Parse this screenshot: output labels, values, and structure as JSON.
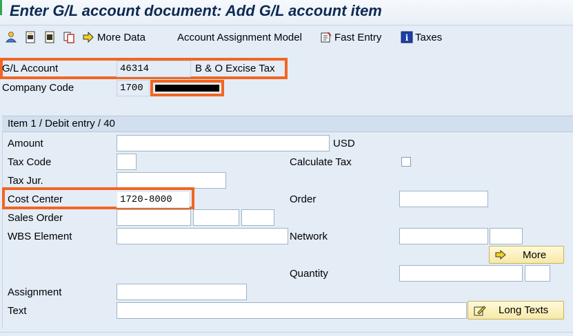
{
  "window": {
    "title": "Enter G/L account document: Add G/L account item"
  },
  "toolbar": {
    "items": [
      {
        "icon": "person-icon"
      },
      {
        "icon": "save-document-icon"
      },
      {
        "icon": "display-document-icon"
      },
      {
        "icon": "copy-icon"
      },
      {
        "icon": "arrow-right-icon",
        "label": "More Data"
      },
      {
        "label": "Account Assignment Model"
      },
      {
        "icon": "fast-entry-icon",
        "label": "Fast Entry"
      },
      {
        "icon": "info-icon",
        "label": "Taxes"
      }
    ]
  },
  "header": {
    "gl_account_label": "G/L Account",
    "gl_account_value": "46314",
    "gl_account_desc": "B & O Excise Tax",
    "company_code_label": "Company Code",
    "company_code_value": "1700"
  },
  "item": {
    "section_title": "Item 1 / Debit entry / 40",
    "amount_label": "Amount",
    "amount_value": "",
    "currency": "USD",
    "tax_code_label": "Tax Code",
    "tax_code_value": "",
    "calculate_tax_label": "Calculate Tax",
    "calculate_tax_checked": false,
    "tax_jur_label": "Tax Jur.",
    "tax_jur_value": "",
    "cost_center_label": "Cost Center",
    "cost_center_value": "1720-8000",
    "order_label": "Order",
    "order_value": "",
    "sales_order_label": "Sales Order",
    "wbs_label": "WBS Element",
    "network_label": "Network",
    "more_button": "More",
    "quantity_label": "Quantity",
    "assignment_label": "Assignment",
    "text_label": "Text",
    "long_texts_button": "Long Texts"
  },
  "colors": {
    "highlight": "#f26522",
    "background": "#e4ecf6",
    "title": "#0d2a52"
  }
}
